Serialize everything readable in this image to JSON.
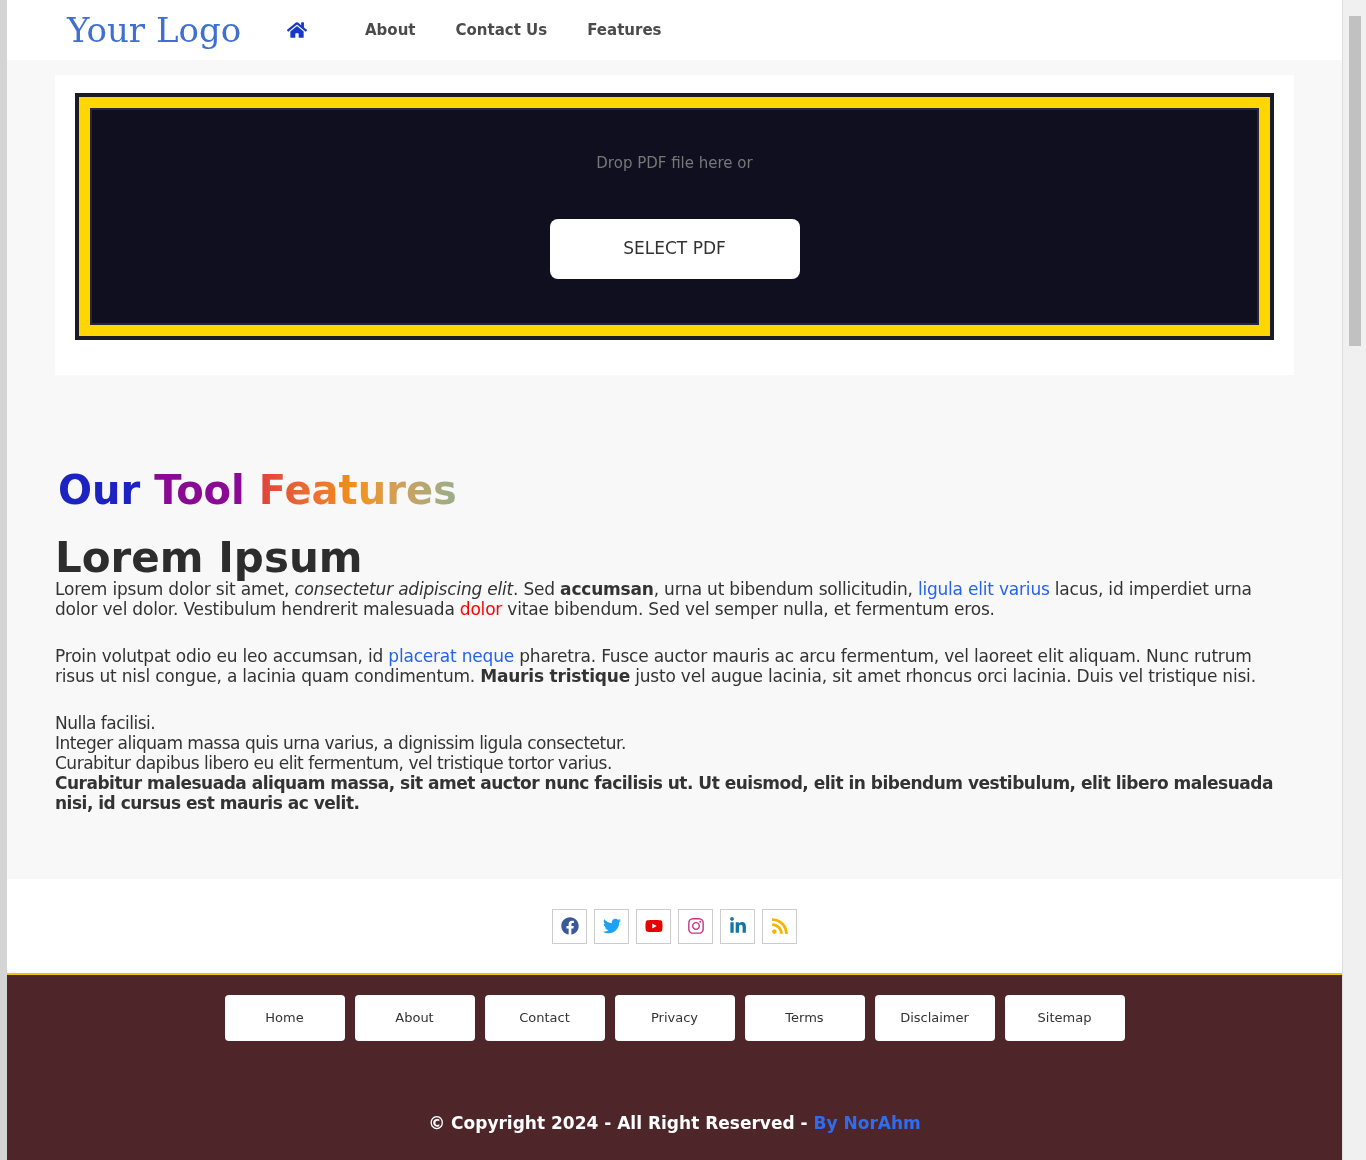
{
  "header": {
    "logo": "Your Logo",
    "nav": [
      "About",
      "Contact Us",
      "Features"
    ]
  },
  "upload": {
    "prompt": "Drop PDF file here or",
    "button": "SELECT PDF"
  },
  "features": {
    "title_words": [
      "Our",
      "Tool",
      "Features"
    ],
    "heading": "Lorem Ipsum",
    "paragraphs": [
      [
        {
          "kind": "plain",
          "text": "Lorem ipsum dolor sit amet, "
        },
        {
          "kind": "italic",
          "text": "consectetur adipiscing elit"
        },
        {
          "kind": "plain",
          "text": ". Sed "
        },
        {
          "kind": "bold",
          "text": "accumsan"
        },
        {
          "kind": "plain",
          "text": ", urna ut bibendum sollicitudin, "
        },
        {
          "kind": "link",
          "text": "ligula elit varius"
        },
        {
          "kind": "plain",
          "text": " lacus, id imperdiet urna dolor vel dolor. Vestibulum hendrerit malesuada "
        },
        {
          "kind": "red",
          "text": "dolor"
        },
        {
          "kind": "plain",
          "text": " vitae bibendum. Sed vel semper nulla, et fermentum eros."
        }
      ],
      [
        {
          "kind": "plain",
          "text": "Proin volutpat odio eu leo accumsan, id "
        },
        {
          "kind": "link",
          "text": "placerat neque"
        },
        {
          "kind": "plain",
          "text": " pharetra. Fusce auctor mauris ac arcu fermentum, vel laoreet elit aliquam. Nunc rutrum risus ut nisl congue, a lacinia quam condimentum. "
        },
        {
          "kind": "bold",
          "text": "Mauris tristique"
        },
        {
          "kind": "plain",
          "text": " justo vel augue lacinia, sit amet rhoncus orci lacinia. Duis vel tristique nisi."
        }
      ]
    ],
    "lines": [
      {
        "text": "Nulla facilisi.",
        "bold": false
      },
      {
        "text": "Integer aliquam massa quis urna varius, a dignissim ligula consectetur.",
        "bold": false
      },
      {
        "text": "Curabitur dapibus libero eu elit fermentum, vel tristique tortor varius.",
        "bold": false
      },
      {
        "text": "Curabitur malesuada aliquam massa, sit amet auctor nunc facilisis ut. Ut euismod, elit in bibendum vestibulum, elit libero malesuada nisi, id cursus est mauris ac velit.",
        "bold": true
      }
    ]
  },
  "social": [
    {
      "kind": "facebook"
    },
    {
      "kind": "twitter"
    },
    {
      "kind": "youtube"
    },
    {
      "kind": "instagram"
    },
    {
      "kind": "linkedin"
    },
    {
      "kind": "rss"
    }
  ],
  "footer": {
    "links": [
      "Home",
      "About",
      "Contact",
      "Privacy",
      "Terms",
      "Disclaimer",
      "Sitemap"
    ],
    "copyright": "© Copyright 2024 - All Right Reserved -",
    "author": "By NorAhm"
  }
}
